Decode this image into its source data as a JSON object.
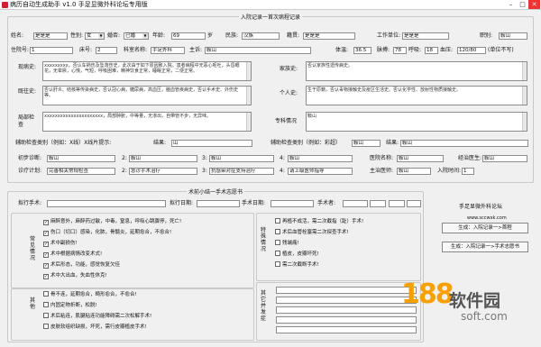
{
  "window": {
    "title": "病历自动生成助手 v1.0 手足显微外科论坛专用版"
  },
  "admission": {
    "legend": "入院记录一首次病程记录",
    "name_l": "姓名:",
    "name": "是是是",
    "sex_l": "性别:",
    "sex": "女",
    "marital_l": "婚否:",
    "marital": "已婚",
    "age_l": "年龄:",
    "age": "69",
    "age_unit": "岁",
    "nation_l": "民族:",
    "nation": "汉族",
    "origin_l": "籍贯:",
    "origin": "是是是",
    "job_l": "工作单位:",
    "job": "是是是",
    "occupation_l": "职别:",
    "occupation": "鞍山",
    "ward_l": "住院号:",
    "ward": "1",
    "bed_l": "床号:",
    "bed": "2",
    "dept_l": "科室名称:",
    "dept": "手足外科",
    "complaint_l": "主诉:",
    "complaint": "鞍山",
    "temp_l": "体温:",
    "temp": "36.5",
    "pulse_l": "脉搏:",
    "pulse": "78",
    "resp_l": "呼吸:",
    "resp": "18",
    "bp_l": "血压:",
    "bp": "120/80",
    "bp_unit": "(单位不写)",
    "hpi_l": "现病史:",
    "hpi": "xxxxxxxxx，否认车祸伤及坠落伤史，此次由于如下原因致入院。患者病程中无恶心呕吐，头昏眼花，无晕厥，心慌，气短，呼吸困难，精神饮食正常，睡眠正常，二便正常。",
    "family_l": "家族史:",
    "family": "否认家族性遗传病史。",
    "past_l": "既往史:",
    "past": "否认肝炎、结核等传染病史，否认冠心病，糖尿病，高血压，脑血管疾病史，否认手术史、外伤史等。",
    "personal_l": "个人史:",
    "personal": "生于原籍，否认毒物接触史及疫区生活史。否认化学性、放射性物质接触史。",
    "spec_l": "局部检查",
    "spec": "xxxxxxxxxxxxxxxxxxxxxx，局部肿胀，中等量，无渗出，自带管不步，无异味。",
    "specsit_l": "专科情况",
    "specsit": "鞍山",
    "aux1_l": "辅助检查类别（例如：X线）X线片提示:",
    "aux1_r_l": "结果:",
    "aux1_r": "山",
    "aux2_l": "辅助检查类别（例如：彩超）",
    "aux2": "鞍山",
    "aux2_r_l": "结果:",
    "aux2_r": "鞍山",
    "diag_l": "初步诊断:",
    "dx": [
      "鞍山",
      "鞍山",
      "鞍山",
      "鞍山"
    ],
    "dx_n": [
      "2:",
      "3:",
      "4:"
    ],
    "hosp_l": "医院名称:",
    "hosp": "鞍山",
    "doc_l": "经治医生:",
    "doc": "鞍山",
    "plan_l": "诊疗计划:",
    "plans": [
      "完善相关常规检查",
      "急诊手术治疗",
      "抗感染对症支持治疗",
      "请上级医师指导"
    ],
    "chief_l": "主治医师:",
    "chief": "鞍山",
    "time_l": "入院时间:",
    "time": "1"
  },
  "surgery": {
    "legend": "术前小结一手术志愿书",
    "op1_l": "拟行手术:",
    "op_date_l": "拟行日期:",
    "op_time_l": "手术日期:",
    "op_type_l": "手术者:",
    "left_group": "常见情况",
    "left_items": [
      "麻醉意外，麻醉药过敏，中毒，窒息，呼吸心跳骤停，死亡!",
      "伤口（切口）感染，化脓，骨髓炎，延期愈合，不愈合!",
      "术中副损伤!",
      "术中根据病情改变术式!",
      "术后形态，功能，感觉恢复欠佳",
      "术中大出血，失血性休克!"
    ],
    "left_checked": [
      true,
      true,
      true,
      true,
      true,
      true
    ],
    "right_group": "特殊情况",
    "right_items": [
      "再植不成活，需二次截指（趾）手术!",
      "术后血管栓塞需二次探查手术!",
      "残端痛!",
      "植皮，皮瓣坏死!",
      "需二次截断手术!"
    ],
    "left_group2": "其他",
    "left_items2": [
      "骨不连，延期愈合，畸形愈合，不愈合!",
      "内固定物折断，松脱!",
      "术后粘连，肌腱粘连功能障碍需二次松解手术!",
      "皮肤软组织缺损，坏死，需行皮瓣植皮手术!"
    ],
    "right_group2": "其它并发症",
    "right_items2": [
      "",
      "",
      "",
      "",
      ""
    ]
  },
  "side": {
    "forum": "手足显微外科论坛",
    "url": "www.sccwxk.com",
    "btn1": "生成：入院记录一>首程",
    "btn2": "生成：入院记录一>手术志愿书"
  },
  "watermark": {
    "n": "188",
    "cn": "软件园",
    "url": "soft.com"
  }
}
